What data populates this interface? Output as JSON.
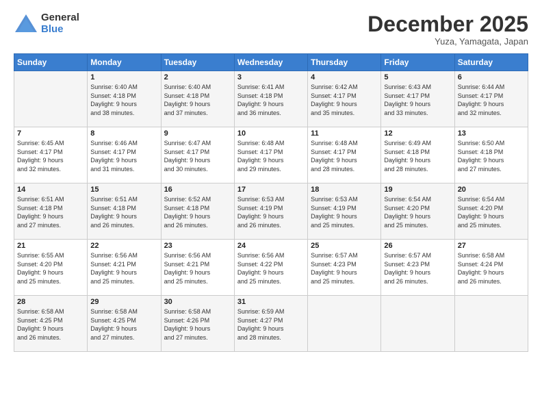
{
  "logo": {
    "general": "General",
    "blue": "Blue"
  },
  "header": {
    "month": "December 2025",
    "location": "Yuza, Yamagata, Japan"
  },
  "weekdays": [
    "Sunday",
    "Monday",
    "Tuesday",
    "Wednesday",
    "Thursday",
    "Friday",
    "Saturday"
  ],
  "weeks": [
    [
      {
        "day": "",
        "info": ""
      },
      {
        "day": "1",
        "info": "Sunrise: 6:40 AM\nSunset: 4:18 PM\nDaylight: 9 hours\nand 38 minutes."
      },
      {
        "day": "2",
        "info": "Sunrise: 6:40 AM\nSunset: 4:18 PM\nDaylight: 9 hours\nand 37 minutes."
      },
      {
        "day": "3",
        "info": "Sunrise: 6:41 AM\nSunset: 4:18 PM\nDaylight: 9 hours\nand 36 minutes."
      },
      {
        "day": "4",
        "info": "Sunrise: 6:42 AM\nSunset: 4:17 PM\nDaylight: 9 hours\nand 35 minutes."
      },
      {
        "day": "5",
        "info": "Sunrise: 6:43 AM\nSunset: 4:17 PM\nDaylight: 9 hours\nand 33 minutes."
      },
      {
        "day": "6",
        "info": "Sunrise: 6:44 AM\nSunset: 4:17 PM\nDaylight: 9 hours\nand 32 minutes."
      }
    ],
    [
      {
        "day": "7",
        "info": "Sunrise: 6:45 AM\nSunset: 4:17 PM\nDaylight: 9 hours\nand 32 minutes."
      },
      {
        "day": "8",
        "info": "Sunrise: 6:46 AM\nSunset: 4:17 PM\nDaylight: 9 hours\nand 31 minutes."
      },
      {
        "day": "9",
        "info": "Sunrise: 6:47 AM\nSunset: 4:17 PM\nDaylight: 9 hours\nand 30 minutes."
      },
      {
        "day": "10",
        "info": "Sunrise: 6:48 AM\nSunset: 4:17 PM\nDaylight: 9 hours\nand 29 minutes."
      },
      {
        "day": "11",
        "info": "Sunrise: 6:48 AM\nSunset: 4:17 PM\nDaylight: 9 hours\nand 28 minutes."
      },
      {
        "day": "12",
        "info": "Sunrise: 6:49 AM\nSunset: 4:18 PM\nDaylight: 9 hours\nand 28 minutes."
      },
      {
        "day": "13",
        "info": "Sunrise: 6:50 AM\nSunset: 4:18 PM\nDaylight: 9 hours\nand 27 minutes."
      }
    ],
    [
      {
        "day": "14",
        "info": "Sunrise: 6:51 AM\nSunset: 4:18 PM\nDaylight: 9 hours\nand 27 minutes."
      },
      {
        "day": "15",
        "info": "Sunrise: 6:51 AM\nSunset: 4:18 PM\nDaylight: 9 hours\nand 26 minutes."
      },
      {
        "day": "16",
        "info": "Sunrise: 6:52 AM\nSunset: 4:18 PM\nDaylight: 9 hours\nand 26 minutes."
      },
      {
        "day": "17",
        "info": "Sunrise: 6:53 AM\nSunset: 4:19 PM\nDaylight: 9 hours\nand 26 minutes."
      },
      {
        "day": "18",
        "info": "Sunrise: 6:53 AM\nSunset: 4:19 PM\nDaylight: 9 hours\nand 25 minutes."
      },
      {
        "day": "19",
        "info": "Sunrise: 6:54 AM\nSunset: 4:20 PM\nDaylight: 9 hours\nand 25 minutes."
      },
      {
        "day": "20",
        "info": "Sunrise: 6:54 AM\nSunset: 4:20 PM\nDaylight: 9 hours\nand 25 minutes."
      }
    ],
    [
      {
        "day": "21",
        "info": "Sunrise: 6:55 AM\nSunset: 4:20 PM\nDaylight: 9 hours\nand 25 minutes."
      },
      {
        "day": "22",
        "info": "Sunrise: 6:56 AM\nSunset: 4:21 PM\nDaylight: 9 hours\nand 25 minutes."
      },
      {
        "day": "23",
        "info": "Sunrise: 6:56 AM\nSunset: 4:21 PM\nDaylight: 9 hours\nand 25 minutes."
      },
      {
        "day": "24",
        "info": "Sunrise: 6:56 AM\nSunset: 4:22 PM\nDaylight: 9 hours\nand 25 minutes."
      },
      {
        "day": "25",
        "info": "Sunrise: 6:57 AM\nSunset: 4:23 PM\nDaylight: 9 hours\nand 25 minutes."
      },
      {
        "day": "26",
        "info": "Sunrise: 6:57 AM\nSunset: 4:23 PM\nDaylight: 9 hours\nand 26 minutes."
      },
      {
        "day": "27",
        "info": "Sunrise: 6:58 AM\nSunset: 4:24 PM\nDaylight: 9 hours\nand 26 minutes."
      }
    ],
    [
      {
        "day": "28",
        "info": "Sunrise: 6:58 AM\nSunset: 4:25 PM\nDaylight: 9 hours\nand 26 minutes."
      },
      {
        "day": "29",
        "info": "Sunrise: 6:58 AM\nSunset: 4:25 PM\nDaylight: 9 hours\nand 27 minutes."
      },
      {
        "day": "30",
        "info": "Sunrise: 6:58 AM\nSunset: 4:26 PM\nDaylight: 9 hours\nand 27 minutes."
      },
      {
        "day": "31",
        "info": "Sunrise: 6:59 AM\nSunset: 4:27 PM\nDaylight: 9 hours\nand 28 minutes."
      },
      {
        "day": "",
        "info": ""
      },
      {
        "day": "",
        "info": ""
      },
      {
        "day": "",
        "info": ""
      }
    ]
  ]
}
